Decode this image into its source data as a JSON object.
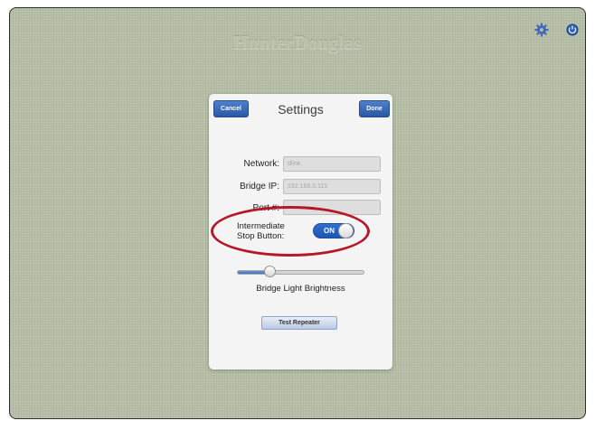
{
  "brand": {
    "logo_text": "HunterDouglas"
  },
  "top_bar": {
    "icons": [
      "gear-icon",
      "power-icon"
    ],
    "accent": "#2f6fd0"
  },
  "settings": {
    "title": "Settings",
    "cancel_label": "Cancel",
    "done_label": "Done",
    "fields": [
      {
        "label": "Network:",
        "value": "dlink"
      },
      {
        "label": "Bridge IP:",
        "value": "192.168.0.115"
      },
      {
        "label": "Port #:",
        "value": ""
      }
    ],
    "stop_button": {
      "label_line1": "Intermediate",
      "label_line2": "Stop Button:",
      "state": "ON",
      "highlighted": true,
      "highlight_color": "#b4182a"
    },
    "brightness": {
      "label": "Bridge Light Brightness",
      "value_fraction": 0.26
    },
    "test_button_label": "Test Repeater"
  }
}
